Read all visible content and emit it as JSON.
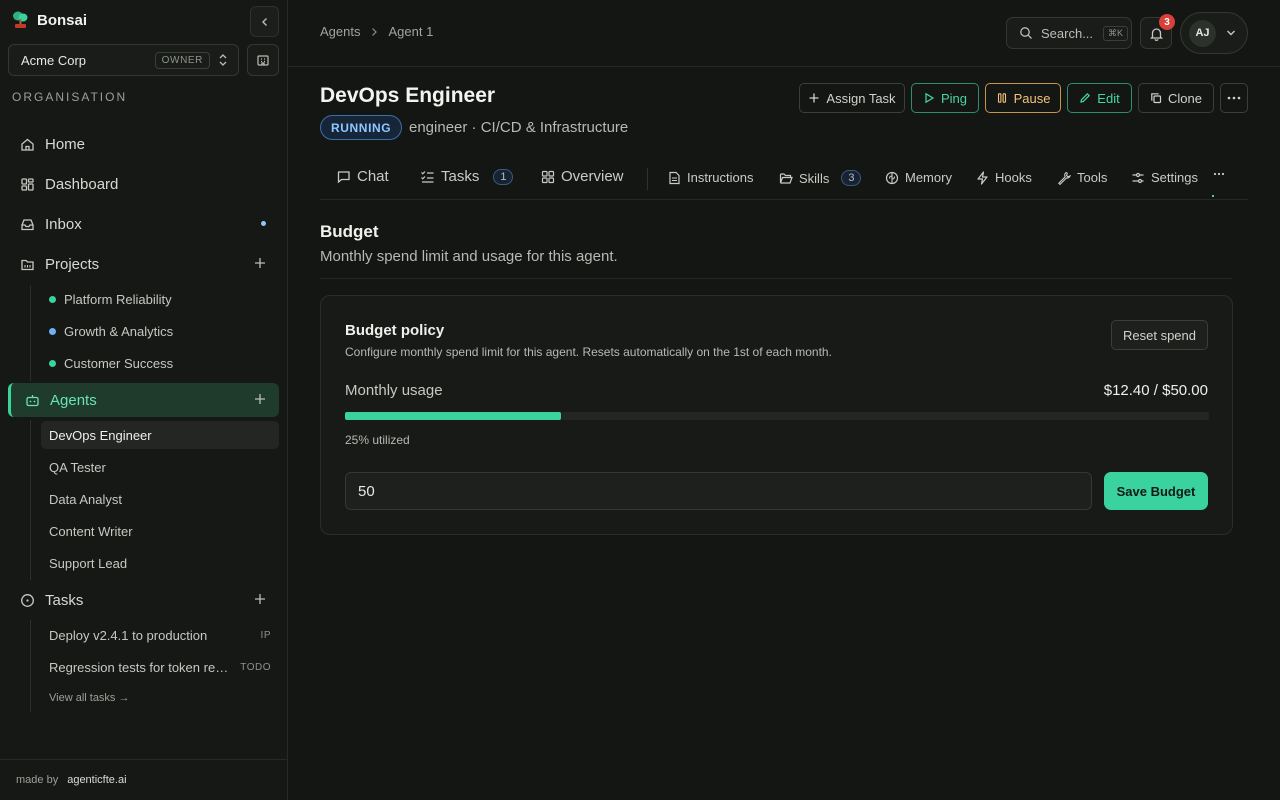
{
  "brand": {
    "name": "Bonsai"
  },
  "org": {
    "name": "Acme Corp",
    "role": "OWNER"
  },
  "sidebar": {
    "section_title": "ORGANISATION",
    "nav": [
      {
        "label": "Home",
        "icon": "home-icon"
      },
      {
        "label": "Dashboard",
        "icon": "dashboard-icon"
      },
      {
        "label": "Inbox",
        "icon": "inbox-icon"
      },
      {
        "label": "Projects",
        "icon": "folder-icon"
      },
      {
        "label": "Agents",
        "icon": "bot-icon"
      },
      {
        "label": "Tasks",
        "icon": "circle-dot-icon"
      }
    ],
    "projects": [
      {
        "label": "Platform Reliability",
        "color": "#3ad29f"
      },
      {
        "label": "Growth & Analytics",
        "color": "#6fb0f0"
      },
      {
        "label": "Customer Success",
        "color": "#3ad29f"
      }
    ],
    "agents": [
      "DevOps Engineer",
      "QA Tester",
      "Data Analyst",
      "Content Writer",
      "Support Lead"
    ],
    "tasks": [
      {
        "label": "Deploy v2.4.1 to production",
        "status": "IP"
      },
      {
        "label": "Regression tests for token refresh",
        "status": "TODO"
      }
    ],
    "view_all": "View all tasks →",
    "footer": {
      "prefix": "made by",
      "link": "agenticfte.ai"
    }
  },
  "topbar": {
    "breadcrumb": [
      "Agents",
      "Agent 1"
    ],
    "search_label": "Search...",
    "search_shortcut": "⌘K",
    "notifications": "3",
    "user_initials": "AJ"
  },
  "agent": {
    "title": "DevOps Engineer",
    "status": "RUNNING",
    "subtitle": "engineer · CI/CD & Infrastructure",
    "actions": [
      "Assign Task",
      "Ping",
      "Pause",
      "Edit",
      "Clone"
    ]
  },
  "tabs": [
    {
      "label": "Chat"
    },
    {
      "label": "Tasks",
      "count": "1"
    },
    {
      "label": "Overview"
    },
    {
      "label": "Instructions"
    },
    {
      "label": "Skills",
      "count": "3"
    },
    {
      "label": "Memory"
    },
    {
      "label": "Hooks"
    },
    {
      "label": "Tools"
    },
    {
      "label": "Settings"
    }
  ],
  "budget": {
    "title": "Budget",
    "description": "Monthly spend limit and usage for this agent.",
    "card_title": "Budget policy",
    "card_description": "Configure monthly spend limit for this agent. Resets automatically on the 1st of each month.",
    "reset_label": "Reset spend",
    "usage_label": "Monthly usage",
    "usage_value": "$12.40 / $50.00",
    "utilized_fraction": 0.25,
    "utilized_text": "25% utilized",
    "input_value": "50",
    "save_label": "Save Budget"
  },
  "colors": {
    "accent": "#3ad29f",
    "running": "#8ec8ff",
    "pause": "#f0c27c",
    "danger": "#d8403a"
  }
}
